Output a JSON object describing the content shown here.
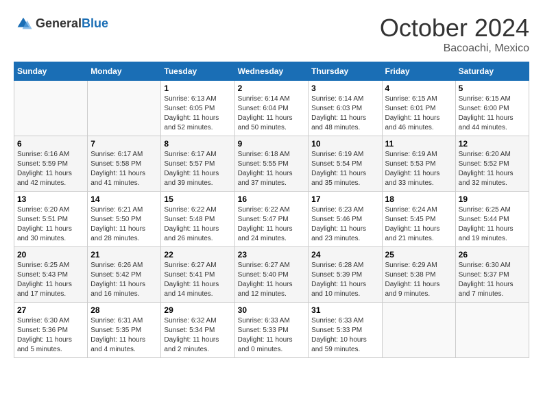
{
  "header": {
    "logo": {
      "general": "General",
      "blue": "Blue"
    },
    "month": "October 2024",
    "location": "Bacoachi, Mexico"
  },
  "days_of_week": [
    "Sunday",
    "Monday",
    "Tuesday",
    "Wednesday",
    "Thursday",
    "Friday",
    "Saturday"
  ],
  "weeks": [
    [
      {
        "day": "",
        "info": ""
      },
      {
        "day": "",
        "info": ""
      },
      {
        "day": "1",
        "info": "Sunrise: 6:13 AM\nSunset: 6:05 PM\nDaylight: 11 hours and 52 minutes."
      },
      {
        "day": "2",
        "info": "Sunrise: 6:14 AM\nSunset: 6:04 PM\nDaylight: 11 hours and 50 minutes."
      },
      {
        "day": "3",
        "info": "Sunrise: 6:14 AM\nSunset: 6:03 PM\nDaylight: 11 hours and 48 minutes."
      },
      {
        "day": "4",
        "info": "Sunrise: 6:15 AM\nSunset: 6:01 PM\nDaylight: 11 hours and 46 minutes."
      },
      {
        "day": "5",
        "info": "Sunrise: 6:15 AM\nSunset: 6:00 PM\nDaylight: 11 hours and 44 minutes."
      }
    ],
    [
      {
        "day": "6",
        "info": "Sunrise: 6:16 AM\nSunset: 5:59 PM\nDaylight: 11 hours and 42 minutes."
      },
      {
        "day": "7",
        "info": "Sunrise: 6:17 AM\nSunset: 5:58 PM\nDaylight: 11 hours and 41 minutes."
      },
      {
        "day": "8",
        "info": "Sunrise: 6:17 AM\nSunset: 5:57 PM\nDaylight: 11 hours and 39 minutes."
      },
      {
        "day": "9",
        "info": "Sunrise: 6:18 AM\nSunset: 5:55 PM\nDaylight: 11 hours and 37 minutes."
      },
      {
        "day": "10",
        "info": "Sunrise: 6:19 AM\nSunset: 5:54 PM\nDaylight: 11 hours and 35 minutes."
      },
      {
        "day": "11",
        "info": "Sunrise: 6:19 AM\nSunset: 5:53 PM\nDaylight: 11 hours and 33 minutes."
      },
      {
        "day": "12",
        "info": "Sunrise: 6:20 AM\nSunset: 5:52 PM\nDaylight: 11 hours and 32 minutes."
      }
    ],
    [
      {
        "day": "13",
        "info": "Sunrise: 6:20 AM\nSunset: 5:51 PM\nDaylight: 11 hours and 30 minutes."
      },
      {
        "day": "14",
        "info": "Sunrise: 6:21 AM\nSunset: 5:50 PM\nDaylight: 11 hours and 28 minutes."
      },
      {
        "day": "15",
        "info": "Sunrise: 6:22 AM\nSunset: 5:48 PM\nDaylight: 11 hours and 26 minutes."
      },
      {
        "day": "16",
        "info": "Sunrise: 6:22 AM\nSunset: 5:47 PM\nDaylight: 11 hours and 24 minutes."
      },
      {
        "day": "17",
        "info": "Sunrise: 6:23 AM\nSunset: 5:46 PM\nDaylight: 11 hours and 23 minutes."
      },
      {
        "day": "18",
        "info": "Sunrise: 6:24 AM\nSunset: 5:45 PM\nDaylight: 11 hours and 21 minutes."
      },
      {
        "day": "19",
        "info": "Sunrise: 6:25 AM\nSunset: 5:44 PM\nDaylight: 11 hours and 19 minutes."
      }
    ],
    [
      {
        "day": "20",
        "info": "Sunrise: 6:25 AM\nSunset: 5:43 PM\nDaylight: 11 hours and 17 minutes."
      },
      {
        "day": "21",
        "info": "Sunrise: 6:26 AM\nSunset: 5:42 PM\nDaylight: 11 hours and 16 minutes."
      },
      {
        "day": "22",
        "info": "Sunrise: 6:27 AM\nSunset: 5:41 PM\nDaylight: 11 hours and 14 minutes."
      },
      {
        "day": "23",
        "info": "Sunrise: 6:27 AM\nSunset: 5:40 PM\nDaylight: 11 hours and 12 minutes."
      },
      {
        "day": "24",
        "info": "Sunrise: 6:28 AM\nSunset: 5:39 PM\nDaylight: 11 hours and 10 minutes."
      },
      {
        "day": "25",
        "info": "Sunrise: 6:29 AM\nSunset: 5:38 PM\nDaylight: 11 hours and 9 minutes."
      },
      {
        "day": "26",
        "info": "Sunrise: 6:30 AM\nSunset: 5:37 PM\nDaylight: 11 hours and 7 minutes."
      }
    ],
    [
      {
        "day": "27",
        "info": "Sunrise: 6:30 AM\nSunset: 5:36 PM\nDaylight: 11 hours and 5 minutes."
      },
      {
        "day": "28",
        "info": "Sunrise: 6:31 AM\nSunset: 5:35 PM\nDaylight: 11 hours and 4 minutes."
      },
      {
        "day": "29",
        "info": "Sunrise: 6:32 AM\nSunset: 5:34 PM\nDaylight: 11 hours and 2 minutes."
      },
      {
        "day": "30",
        "info": "Sunrise: 6:33 AM\nSunset: 5:33 PM\nDaylight: 11 hours and 0 minutes."
      },
      {
        "day": "31",
        "info": "Sunrise: 6:33 AM\nSunset: 5:33 PM\nDaylight: 10 hours and 59 minutes."
      },
      {
        "day": "",
        "info": ""
      },
      {
        "day": "",
        "info": ""
      }
    ]
  ]
}
